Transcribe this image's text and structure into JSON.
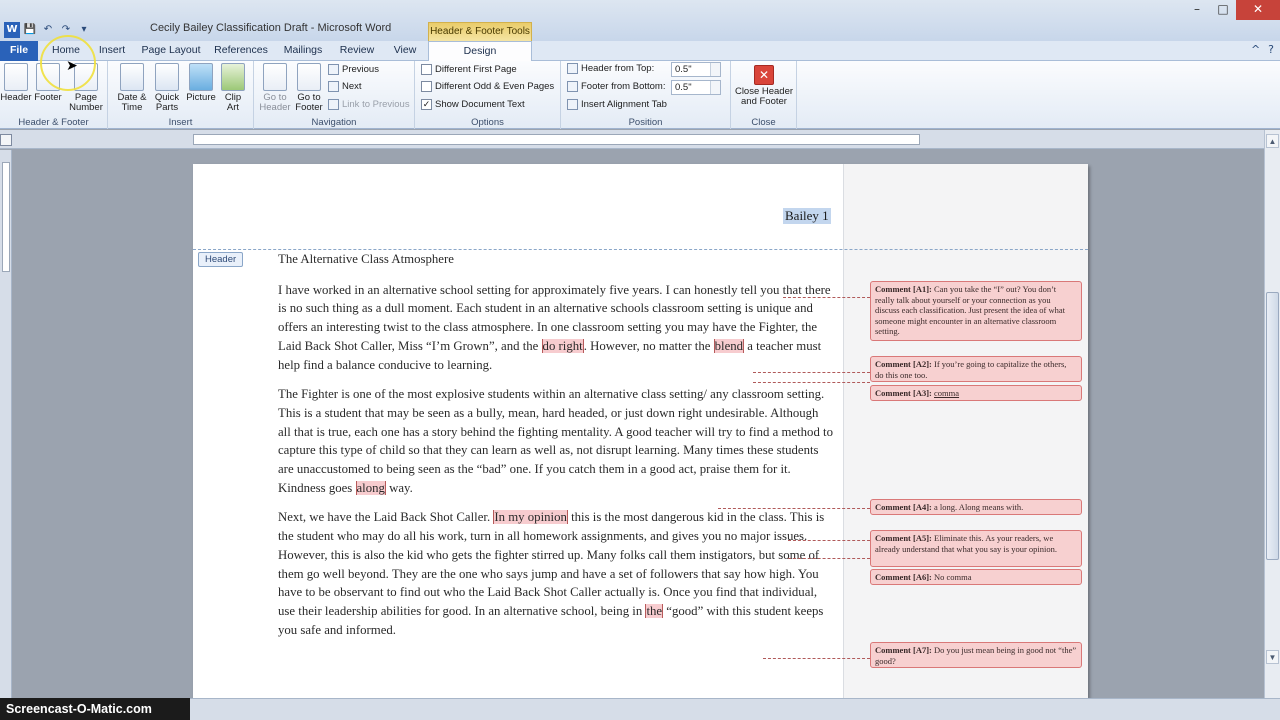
{
  "window": {
    "title": "Cecily Bailey Classification Draft - Microsoft Word",
    "contextual_group": "Header & Footer Tools"
  },
  "quick_access": {
    "word_icon": "W",
    "save": "💾",
    "undo": "↶",
    "redo": "↷",
    "customize": "▾"
  },
  "window_controls": {
    "minimize": "–",
    "maximize": "□",
    "close": "✕"
  },
  "tabs": [
    "File",
    "Home",
    "Insert",
    "Page Layout",
    "References",
    "Mailings",
    "Review",
    "View",
    "Design"
  ],
  "help_icons": {
    "minimize_ribbon": "^",
    "help": "?"
  },
  "ribbon": {
    "header_footer": {
      "label": "Header & Footer",
      "header": "Header",
      "footer": "Footer",
      "page_number": "Page Number"
    },
    "insert": {
      "label": "Insert",
      "date_time": "Date & Time",
      "quick_parts": "Quick Parts",
      "picture": "Picture",
      "clip_art": "Clip Art"
    },
    "navigation": {
      "label": "Navigation",
      "go_to_header": "Go to Header",
      "go_to_footer": "Go to Footer",
      "previous": "Previous",
      "next": "Next",
      "link_to_previous": "Link to Previous"
    },
    "options": {
      "label": "Options",
      "different_first_page": "Different First Page",
      "different_odd_even": "Different Odd & Even Pages",
      "show_document_text": "Show Document Text",
      "show_document_text_checked": true
    },
    "position": {
      "label": "Position",
      "header_from_top": "Header from Top:",
      "header_from_top_value": "0.5\"",
      "footer_from_bottom": "Footer from Bottom:",
      "footer_from_bottom_value": "0.5\"",
      "insert_alignment_tab": "Insert Alignment Tab"
    },
    "close": {
      "label": "Close",
      "close_header_footer": "Close Header and Footer"
    }
  },
  "document": {
    "header_text": "Bailey 1",
    "header_tag": "Header",
    "title": "The Alternative Class Atmosphere",
    "p1": {
      "a": "I have worked in an alternative school setting for approximately five years. I can honestly tell you that there is no such thing as a dull moment. Each student in an alternative schools classroom setting is unique and offers an interesting twist to the class atmosphere. In one classroom setting you may have the Fighter, the Laid Back Shot Caller, Miss “I’m Grown”, and the ",
      "hl1": "do right",
      "b": ". However, no matter the ",
      "hl2": "blend",
      "c": " a teacher must help find a balance conducive to learning."
    },
    "p2": {
      "a": "The Fighter is one of the most explosive students within an alternative class setting/ any classroom setting. This is a student that may be seen as a bully, mean, hard headed, or just down right undesirable. Although all that is true, each one has a story behind the fighting mentality. A good teacher will try to find a method to capture this type of child so that they can learn as well as, not disrupt learning. Many times these students are unaccustomed to being seen as the “bad” one. If you catch them in a good act, praise them for it. Kindness goes ",
      "hl1": "along",
      "b": " way."
    },
    "p3": {
      "a": "Next, we have the Laid Back Shot Caller. ",
      "hl1": "In my opinion",
      "b": " this is the most dangerous kid in the class. This is the student who",
      "c": " may do all his work, turn in all homework assignments, and gives you no major issues. However, this is also the kid who gets the fighter stirred up. Many folks call them instigators, but some of them go well beyond. They are the one who says jump and have a set of followers that say how high. You have to be observant to find out who the Laid Back Shot Caller actually is. Once you find that individual, use their leadership abilities for good. In an alternative school, being in ",
      "hl2": "the",
      "d": " “good” with this student keeps you safe and informed."
    }
  },
  "comments": [
    {
      "id": "Comment [A1]:",
      "text": "Can you take the “I” out?  You don’t really talk about yourself or your connection as you discuss each classification.  Just present the idea of what someone might encounter in an alternative classroom setting."
    },
    {
      "id": "Comment [A2]:",
      "text": "If you’re going to capitalize the others, do this one too."
    },
    {
      "id": "Comment [A3]:",
      "text": "comma"
    },
    {
      "id": "Comment [A4]:",
      "text": "a long.  Along means with."
    },
    {
      "id": "Comment [A5]:",
      "text": "Eliminate this.  As your readers, we already understand that what you say is your opinion."
    },
    {
      "id": "Comment [A6]:",
      "text": "No comma"
    },
    {
      "id": "Comment [A7]:",
      "text": "Do you just mean being in good not “the” good?"
    }
  ],
  "watermark": "Screencast-O-Matic.com",
  "colors": {
    "file_tab": "#2a62b9",
    "comment_bg": "#f7d0d0",
    "comment_border": "#d97878",
    "header_highlight": "#c3d6ee",
    "contextual_tab": "#e9cc6a"
  }
}
